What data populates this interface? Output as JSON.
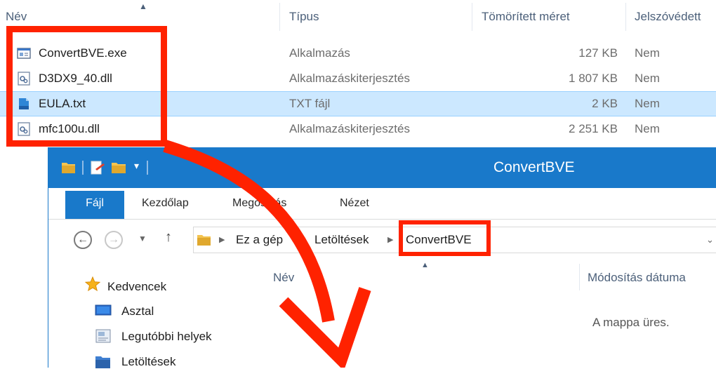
{
  "zip_list": {
    "columns": [
      "Név",
      "Típus",
      "Tömörített méret",
      "Jelszóvédett"
    ],
    "rows": [
      {
        "name": "ConvertBVE.exe",
        "type": "Alkalmazás",
        "size": "127 KB",
        "protected": "Nem",
        "icon": "exe-icon",
        "selected": false
      },
      {
        "name": "D3DX9_40.dll",
        "type": "Alkalmazáskiterjesztés",
        "size": "1 807 KB",
        "protected": "Nem",
        "icon": "dll-icon",
        "selected": false
      },
      {
        "name": "EULA.txt",
        "type": "TXT fájl",
        "size": "2 KB",
        "protected": "Nem",
        "icon": "txt-icon",
        "selected": true
      },
      {
        "name": "mfc100u.dll",
        "type": "Alkalmazáskiterjesztés",
        "size": "2 251 KB",
        "protected": "Nem",
        "icon": "dll-icon",
        "selected": false
      }
    ]
  },
  "window": {
    "title": "ConvertBVE",
    "tabs": [
      "Fájl",
      "Kezdőlap",
      "Megosztás",
      "Nézet"
    ],
    "breadcrumb": [
      "Ez a gép",
      "Letöltések",
      "ConvertBVE"
    ],
    "nav": {
      "favorites": "Kedvencek",
      "items": [
        "Asztal",
        "Legutóbbi helyek",
        "Letöltések"
      ]
    },
    "content": {
      "col_name": "Név",
      "col_date": "Módosítás dátuma",
      "empty_text": "A mappa üres."
    }
  },
  "colors": {
    "highlight": "#ff2200",
    "titlebar": "#1979ca",
    "selection": "#cce8ff"
  }
}
